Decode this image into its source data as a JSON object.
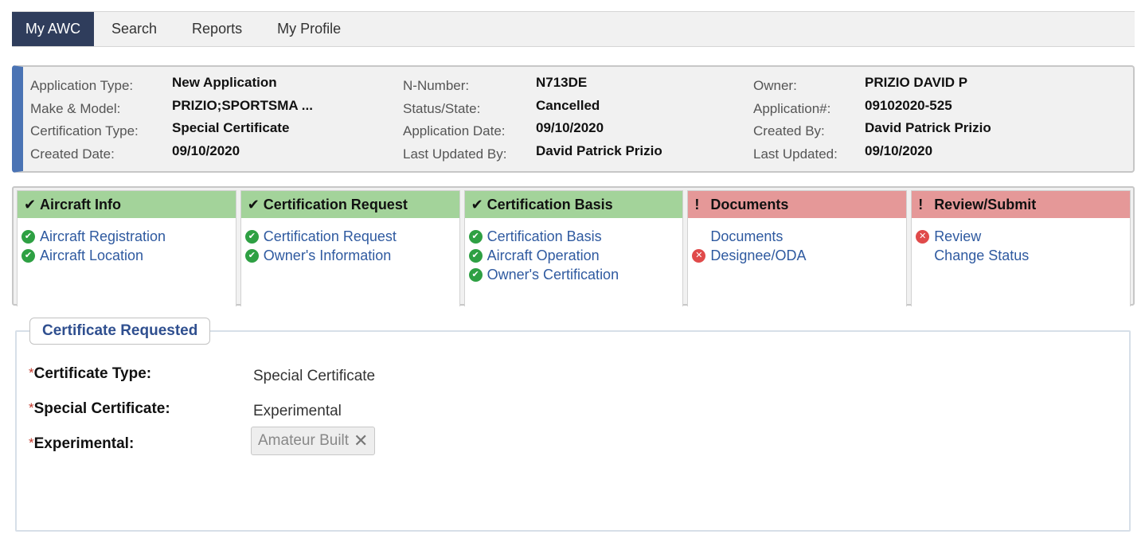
{
  "nav": {
    "tabs": [
      {
        "label": "My AWC",
        "active": true
      },
      {
        "label": "Search"
      },
      {
        "label": "Reports"
      },
      {
        "label": "My Profile"
      }
    ]
  },
  "summary": {
    "col1": [
      {
        "label": "Application Type:",
        "value": "New Application"
      },
      {
        "label": "Make & Model:",
        "value": "PRIZIO;SPORTSMA ..."
      },
      {
        "label": "Certification Type:",
        "value": "Special Certificate"
      },
      {
        "label": "Created Date:",
        "value": "09/10/2020"
      }
    ],
    "col2": [
      {
        "label": "N-Number:",
        "value": "N713DE"
      },
      {
        "label": "Status/State:",
        "value": "Cancelled"
      },
      {
        "label": "Application Date:",
        "value": "09/10/2020"
      },
      {
        "label": "Last Updated By:",
        "value": "David Patrick Prizio"
      }
    ],
    "col3": [
      {
        "label": "Owner:",
        "value": "PRIZIO DAVID P"
      },
      {
        "label": "Application#:",
        "value": "09102020-525"
      },
      {
        "label": "Created By:",
        "value": "David Patrick Prizio"
      },
      {
        "label": "Last Updated:",
        "value": "09/10/2020"
      }
    ]
  },
  "steps": [
    {
      "title": "Aircraft Info",
      "status_icon": "✔",
      "items": [
        {
          "label": "Aircraft Registration",
          "icon": "check-circle-icon"
        },
        {
          "label": "Aircraft Location",
          "icon": "check-circle-icon"
        }
      ]
    },
    {
      "title": "Certification Request",
      "status_icon": "✔",
      "items": [
        {
          "label": "Certification Request",
          "icon": "check-circle-icon"
        },
        {
          "label": "Owner's Information",
          "icon": "check-circle-icon"
        }
      ]
    },
    {
      "title": "Certification Basis",
      "status_icon": "✔",
      "items": [
        {
          "label": "Certification Basis",
          "icon": "check-circle-icon"
        },
        {
          "label": "Aircraft Operation",
          "icon": "check-circle-icon"
        },
        {
          "label": "Owner's Certification",
          "icon": "check-circle-icon"
        }
      ]
    },
    {
      "title": "Documents",
      "status_icon": "!",
      "items": [
        {
          "label": "Documents",
          "icon": ""
        },
        {
          "label": "Designee/ODA",
          "icon": "error-circle-icon"
        }
      ]
    },
    {
      "title": "Review/Submit",
      "status_icon": "!",
      "items": [
        {
          "label": "Review",
          "icon": "error-circle-icon"
        },
        {
          "label": "Change Status",
          "icon": ""
        }
      ]
    }
  ],
  "certificate": {
    "legend": "Certificate Requested",
    "required_mark": "*",
    "certificate_type": {
      "label": "Certificate Type:",
      "value": "Special Certificate"
    },
    "special_certificate": {
      "label": "Special Certificate:",
      "value": "Experimental"
    },
    "experimental": {
      "label": "Experimental:",
      "tag": "Amateur Built",
      "remove": "✕"
    }
  },
  "colors": {
    "nav_active": "#2f3d5c",
    "summary_accent": "#4a73b4",
    "step_ok": "#a3d39a",
    "step_bad": "#e59898",
    "link": "#2f5aa0",
    "icon_ok": "#2ea043",
    "icon_error": "#e04a4a",
    "legend_text": "#2f4f8f"
  }
}
